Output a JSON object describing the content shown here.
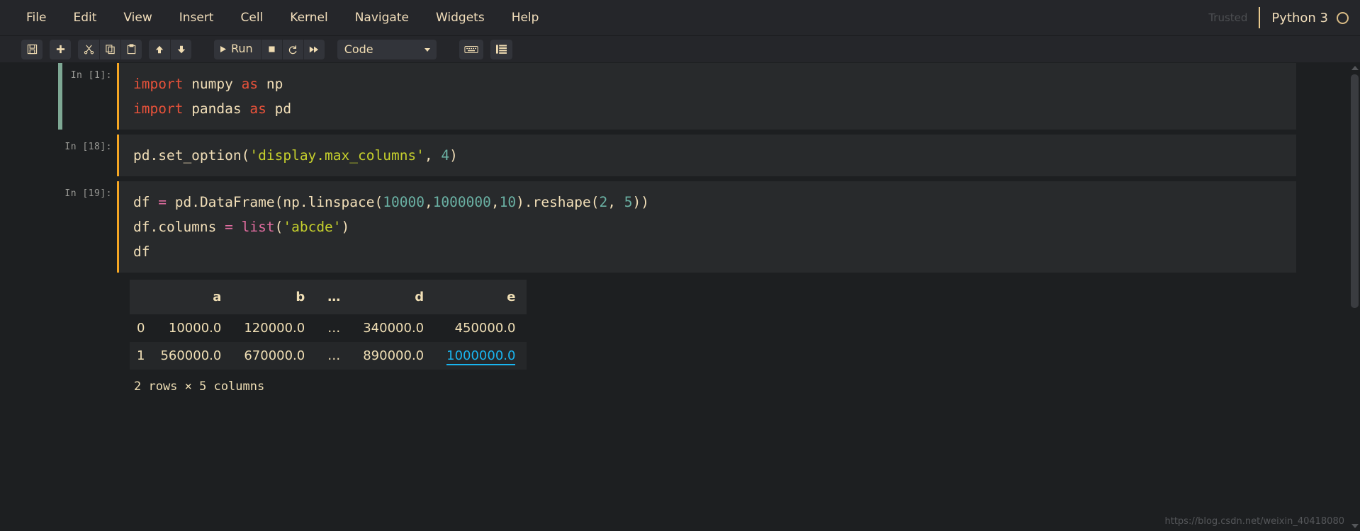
{
  "menubar": {
    "items": [
      {
        "label": "File"
      },
      {
        "label": "Edit"
      },
      {
        "label": "View"
      },
      {
        "label": "Insert"
      },
      {
        "label": "Cell"
      },
      {
        "label": "Kernel"
      },
      {
        "label": "Navigate"
      },
      {
        "label": "Widgets"
      },
      {
        "label": "Help"
      }
    ],
    "trusted_label": "Trusted",
    "kernel_name": "Python 3",
    "kernel_status_icon": "circle-idle-icon"
  },
  "toolbar": {
    "save_icon": "floppy-disk-icon",
    "insert_icon": "plus-icon",
    "cut_icon": "scissors-icon",
    "copy_icon": "copy-icon",
    "paste_icon": "paste-icon",
    "move_up_icon": "arrow-up-icon",
    "move_down_icon": "arrow-down-icon",
    "run_label": "Run",
    "run_icon": "play-icon",
    "interrupt_icon": "stop-square-icon",
    "restart_icon": "restart-circular-arrow-icon",
    "restart_run_all_icon": "fast-forward-icon",
    "celltype_value": "Code",
    "keyboard_icon": "keyboard-icon",
    "command_palette_icon": "list-lines-icon"
  },
  "colors": {
    "background": "#1d1f21",
    "chrome": "#25262a",
    "cell_background": "#282a2c",
    "accent_text": "#f2debb",
    "cell_bar": "#f5a623",
    "selected_bar": "#7ea894",
    "keyword": "#e8523a",
    "string": "#c5cf2c",
    "number": "#6ab0a3",
    "operator": "#e06c9f",
    "highlight": "#19b5f0"
  },
  "cells": [
    {
      "prompt": "In [1]:",
      "selected": true,
      "lines": [
        [
          {
            "t": "import",
            "c": "kw"
          },
          {
            "t": " numpy ",
            "c": "fn"
          },
          {
            "t": "as",
            "c": "kw"
          },
          {
            "t": " np",
            "c": "fn"
          }
        ],
        [
          {
            "t": "import",
            "c": "kw"
          },
          {
            "t": " pandas ",
            "c": "fn"
          },
          {
            "t": "as",
            "c": "kw"
          },
          {
            "t": " pd",
            "c": "fn"
          }
        ]
      ]
    },
    {
      "prompt": "In [18]:",
      "selected": false,
      "lines": [
        [
          {
            "t": "pd.set_option(",
            "c": "fn"
          },
          {
            "t": "'display.max_columns'",
            "c": "str"
          },
          {
            "t": ", ",
            "c": "fn"
          },
          {
            "t": "4",
            "c": "num"
          },
          {
            "t": ")",
            "c": "fn"
          }
        ]
      ]
    },
    {
      "prompt": "In [19]:",
      "selected": false,
      "lines": [
        [
          {
            "t": "df ",
            "c": "fn"
          },
          {
            "t": "=",
            "c": "op"
          },
          {
            "t": " pd.DataFrame(np.linspace(",
            "c": "fn"
          },
          {
            "t": "10000",
            "c": "num"
          },
          {
            "t": ",",
            "c": "fn"
          },
          {
            "t": "1000000",
            "c": "num"
          },
          {
            "t": ",",
            "c": "fn"
          },
          {
            "t": "10",
            "c": "num"
          },
          {
            "t": ").reshape(",
            "c": "fn"
          },
          {
            "t": "2",
            "c": "num"
          },
          {
            "t": ", ",
            "c": "fn"
          },
          {
            "t": "5",
            "c": "num"
          },
          {
            "t": "))",
            "c": "fn"
          }
        ],
        [
          {
            "t": "df.columns ",
            "c": "fn"
          },
          {
            "t": "=",
            "c": "op"
          },
          {
            "t": " ",
            "c": "fn"
          },
          {
            "t": "list",
            "c": "bi"
          },
          {
            "t": "(",
            "c": "fn"
          },
          {
            "t": "'abcde'",
            "c": "str"
          },
          {
            "t": ")",
            "c": "fn"
          }
        ],
        [
          {
            "t": "df",
            "c": "fn"
          }
        ]
      ]
    }
  ],
  "output": {
    "table": {
      "index_header": "",
      "columns": [
        "a",
        "b",
        "…",
        "d",
        "e"
      ],
      "rows": [
        {
          "index": "0",
          "values": [
            "10000.0",
            "120000.0",
            "…",
            "340000.0",
            "450000.0"
          ]
        },
        {
          "index": "1",
          "values": [
            "560000.0",
            "670000.0",
            "…",
            "890000.0",
            "1000000.0"
          ]
        }
      ],
      "highlighted_cell": "1000000.0"
    },
    "shape_note": "2 rows × 5 columns"
  },
  "watermark": "https://blog.csdn.net/weixin_40418080"
}
